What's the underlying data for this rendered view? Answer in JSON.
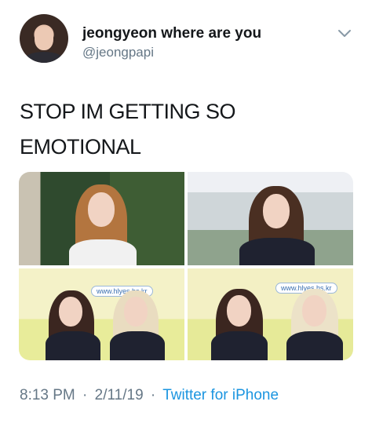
{
  "tweet": {
    "author": {
      "display_name": "jeongyeon where are you",
      "handle": "@jeongpapi"
    },
    "text_line1": "STOP IM GETTING SO",
    "text_line2": "EMOTIONAL",
    "media": {
      "photo_count": 4,
      "sign_text": "www.hlyes.hs.kr"
    },
    "time": "8:13 PM",
    "date": "2/11/19",
    "separator": "·",
    "source": "Twitter for iPhone"
  },
  "icons": {
    "menu": "chevron-down-icon"
  },
  "colors": {
    "primary_text": "#14171a",
    "secondary_text": "#657786",
    "link": "#1b95e0"
  }
}
